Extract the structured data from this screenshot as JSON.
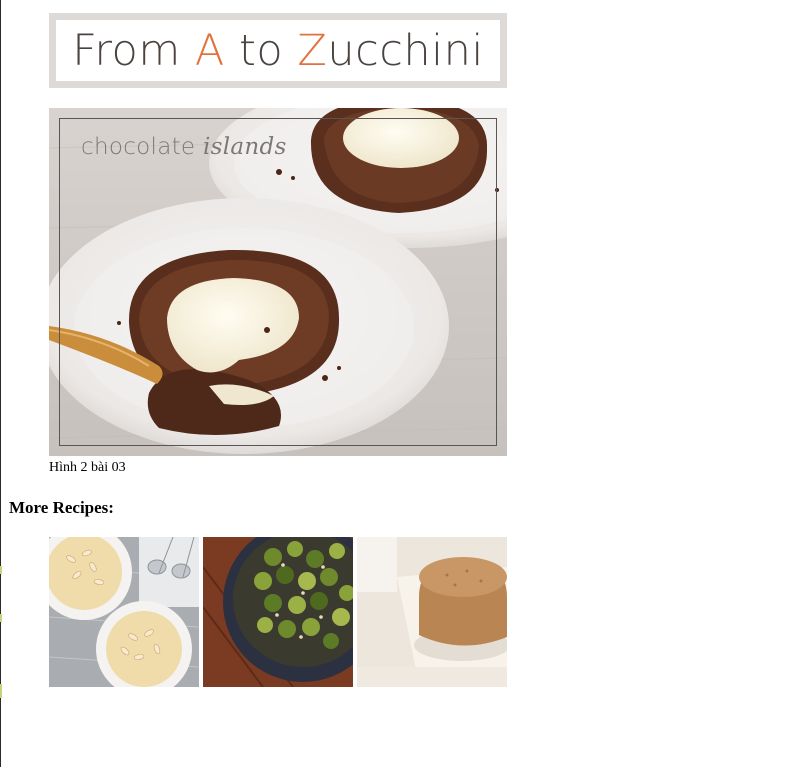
{
  "logo": {
    "part1": "From ",
    "accent1": "A",
    "part2": " to ",
    "accent2": "Z",
    "part3": "ucchini"
  },
  "hero": {
    "title_plain": "chocolate ",
    "title_emphasis": "islands"
  },
  "caption": "Hình 2 bài 03",
  "more_recipes": {
    "heading": "More Recipes:",
    "thumbnails": [
      {
        "name": "custard-with-almonds"
      },
      {
        "name": "roasted-brussels-sprouts"
      },
      {
        "name": "cake"
      }
    ]
  },
  "colors": {
    "accent": "#e0733d",
    "logo_text": "#4a4340",
    "logo_border": "#dedad7"
  }
}
